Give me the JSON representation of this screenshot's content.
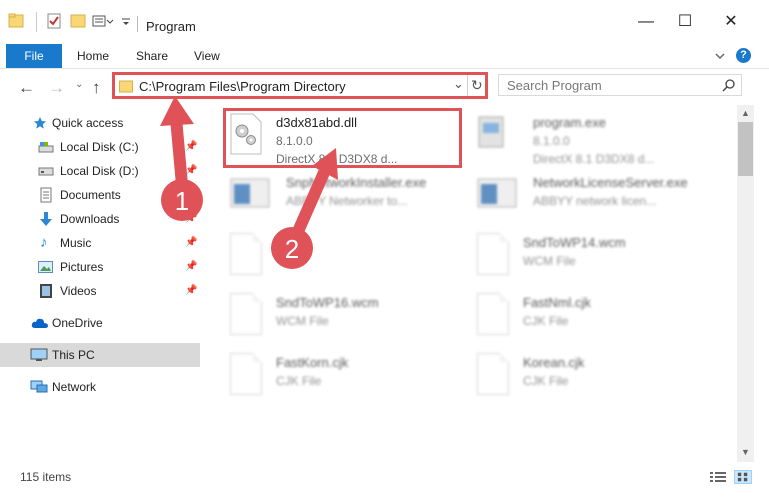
{
  "window": {
    "title": "Program",
    "controls": {
      "minimize": "—",
      "maximize": "☐",
      "close": "✕"
    }
  },
  "ribbon": {
    "tabs": [
      "File",
      "Home",
      "Share",
      "View"
    ],
    "collapse_icon": "chevron-down-icon",
    "help_icon": "?"
  },
  "nav": {
    "address": "C:\\Program Files\\Program Directory",
    "search_placeholder": "Search Program",
    "dropdown": "⌄",
    "refresh": "↻"
  },
  "sidebar": {
    "items": [
      {
        "label": "Quick access",
        "icon": "star-icon",
        "pinned": false
      },
      {
        "label": "Local Disk (C:)",
        "icon": "drive-icon",
        "pinned": true
      },
      {
        "label": "Local Disk (D:)",
        "icon": "drive-icon",
        "pinned": true
      },
      {
        "label": "Documents",
        "icon": "documents-icon",
        "pinned": true
      },
      {
        "label": "Downloads",
        "icon": "download-icon",
        "pinned": true
      },
      {
        "label": "Music",
        "icon": "music-icon",
        "pinned": true
      },
      {
        "label": "Pictures",
        "icon": "pictures-icon",
        "pinned": true
      },
      {
        "label": "Videos",
        "icon": "videos-icon",
        "pinned": true
      },
      {
        "label": "OneDrive",
        "icon": "cloud-icon",
        "pinned": false
      },
      {
        "label": "This PC",
        "icon": "computer-icon",
        "pinned": false,
        "selected": true
      },
      {
        "label": "Network",
        "icon": "network-icon",
        "pinned": false
      }
    ]
  },
  "files": [
    {
      "name": "d3dx81abd.dll",
      "line1": "8.1.0.0",
      "line2": "DirectX 8.1 D3DX8 d...",
      "icon": "dll-gear-icon",
      "highlighted": true
    },
    {
      "name": "program.exe",
      "line1": "8.1.0.0",
      "line2": "DirectX 8.1 D3DX8 d...",
      "icon": "exe-icon",
      "blurred": true
    },
    {
      "name": "SnpNetworkInstaller.exe",
      "line1": "ABBYY Networker to...",
      "line2": "",
      "icon": "window-app-icon",
      "blurred": true
    },
    {
      "name": "NetworkLicenseServer.exe",
      "line1": "ABBYY network licen...",
      "line2": "",
      "icon": "window-app-icon",
      "blurred": true
    },
    {
      "name": "",
      "line1": "",
      "line2": "",
      "icon": "file-icon",
      "blurred": true
    },
    {
      "name": "SndToWP14.wcm",
      "line1": "WCM File",
      "line2": "",
      "icon": "file-icon",
      "blurred": true
    },
    {
      "name": "SndToWP16.wcm",
      "line1": "WCM File",
      "line2": "",
      "icon": "file-icon",
      "blurred": true
    },
    {
      "name": "FastNml.cjk",
      "line1": "CJK File",
      "line2": "",
      "icon": "file-icon",
      "blurred": true
    },
    {
      "name": "FastKorn.cjk",
      "line1": "CJK File",
      "line2": "",
      "icon": "file-icon",
      "blurred": true
    },
    {
      "name": "Korean.cjk",
      "line1": "CJK File",
      "line2": "",
      "icon": "file-icon",
      "blurred": true
    }
  ],
  "annotations": {
    "callout_1": "1",
    "callout_2": "2",
    "color": "#df5258"
  },
  "status": {
    "item_count": "115 items"
  },
  "colors": {
    "accent": "#1979ca",
    "selected_bg": "#e5f3ff",
    "this_pc_bg": "#d9d9d9",
    "highlight": "#df5258"
  }
}
